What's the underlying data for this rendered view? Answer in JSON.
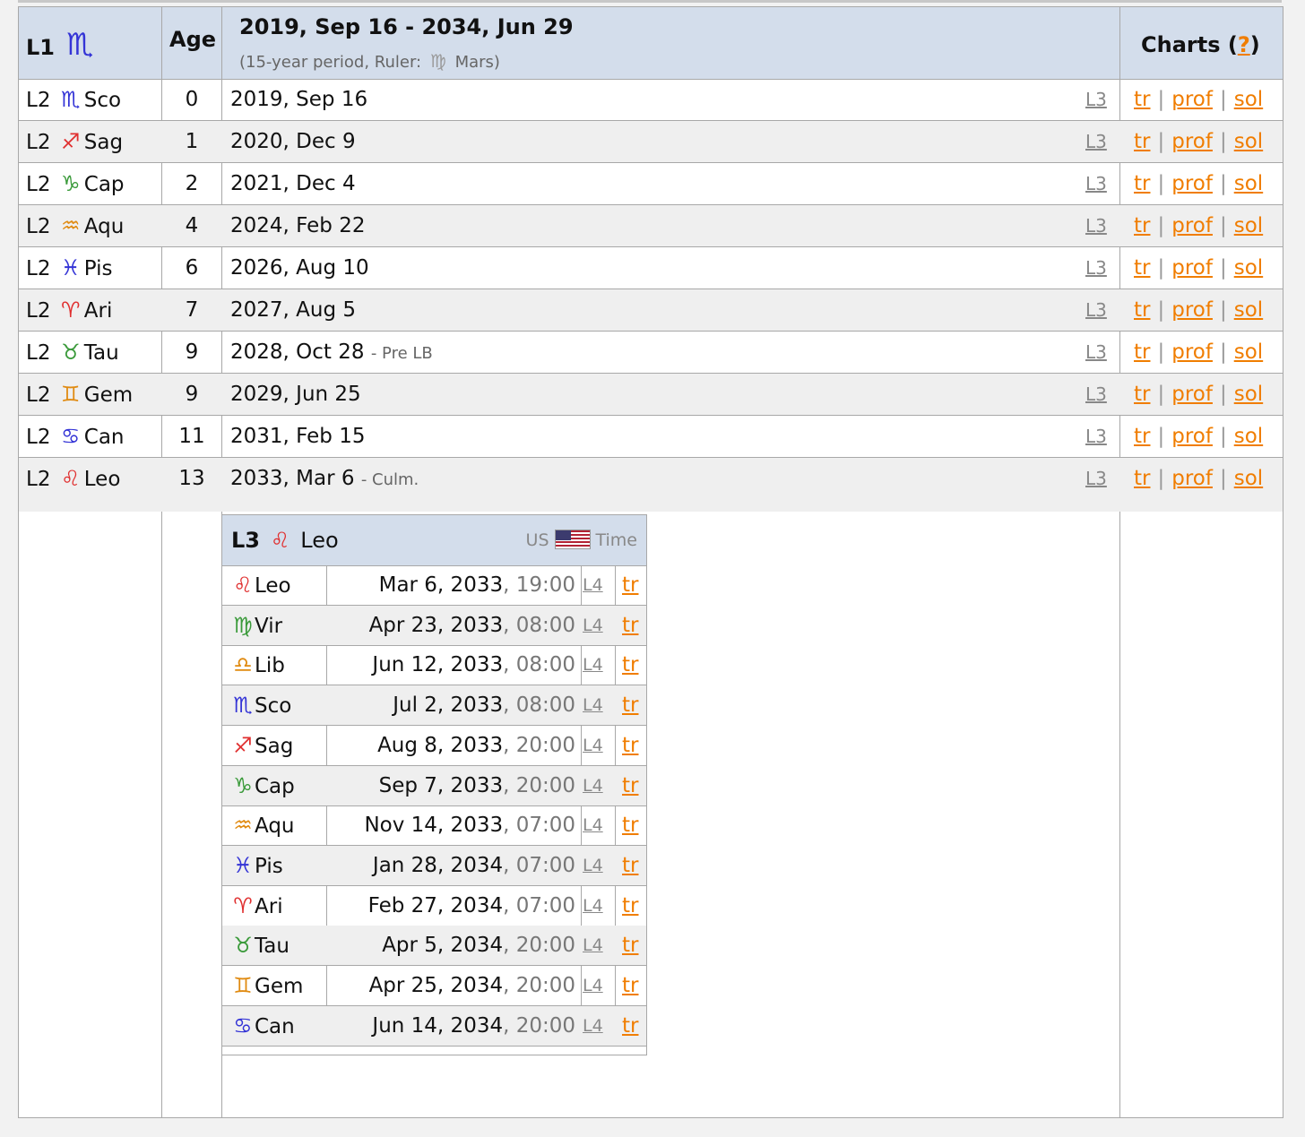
{
  "header": {
    "level_label": "L1",
    "level_sign_icon": "scorpio-icon",
    "level_symbol": "♏",
    "age_label": "Age",
    "period_title": "2019, Sep 16 - 2034, Jun 29",
    "period_sub_prefix": "(15-year period, Ruler:",
    "ruler_symbol": "♍",
    "ruler_name": "Mars)",
    "charts_label": "Charts (",
    "charts_help": "?",
    "charts_close": ")"
  },
  "rows": [
    {
      "level": "L2",
      "symbol": "♏",
      "abbr": "Sco",
      "age": "0",
      "date": "2019, Sep 16",
      "note": "",
      "l3": "L3",
      "tr": "tr",
      "prof": "prof",
      "sol": "sol"
    },
    {
      "level": "L2",
      "symbol": "♐",
      "abbr": "Sag",
      "age": "1",
      "date": "2020, Dec 9",
      "note": "",
      "l3": "L3",
      "tr": "tr",
      "prof": "prof",
      "sol": "sol"
    },
    {
      "level": "L2",
      "symbol": "♑",
      "abbr": "Cap",
      "age": "2",
      "date": "2021, Dec 4",
      "note": "",
      "l3": "L3",
      "tr": "tr",
      "prof": "prof",
      "sol": "sol"
    },
    {
      "level": "L2",
      "symbol": "♒",
      "abbr": "Aqu",
      "age": "4",
      "date": "2024, Feb 22",
      "note": "",
      "l3": "L3",
      "tr": "tr",
      "prof": "prof",
      "sol": "sol"
    },
    {
      "level": "L2",
      "symbol": "♓",
      "abbr": "Pis",
      "age": "6",
      "date": "2026, Aug 10",
      "note": "",
      "l3": "L3",
      "tr": "tr",
      "prof": "prof",
      "sol": "sol"
    },
    {
      "level": "L2",
      "symbol": "♈",
      "abbr": "Ari",
      "age": "7",
      "date": "2027, Aug 5",
      "note": "",
      "l3": "L3",
      "tr": "tr",
      "prof": "prof",
      "sol": "sol"
    },
    {
      "level": "L2",
      "symbol": "♉",
      "abbr": "Tau",
      "age": "9",
      "date": "2028, Oct 28",
      "note": "- Pre LB",
      "l3": "L3",
      "tr": "tr",
      "prof": "prof",
      "sol": "sol"
    },
    {
      "level": "L2",
      "symbol": "♊",
      "abbr": "Gem",
      "age": "9",
      "date": "2029, Jun 25",
      "note": "",
      "l3": "L3",
      "tr": "tr",
      "prof": "prof",
      "sol": "sol"
    },
    {
      "level": "L2",
      "symbol": "♋",
      "abbr": "Can",
      "age": "11",
      "date": "2031, Feb 15",
      "note": "",
      "l3": "L3",
      "tr": "tr",
      "prof": "prof",
      "sol": "sol"
    },
    {
      "level": "L2",
      "symbol": "♌",
      "abbr": "Leo",
      "age": "13",
      "date": "2033, Mar 6",
      "note": "- Culm.",
      "l3": "L3",
      "tr": "tr",
      "prof": "prof",
      "sol": "sol"
    }
  ],
  "separator": "|",
  "subtable": {
    "level": "L3",
    "symbol": "♌",
    "name": "Leo",
    "tz_left": "US",
    "tz_right": "Time",
    "rows": [
      {
        "symbol": "♌",
        "abbr": "Leo",
        "date": "Mar 6, 2033",
        "time": ", 19:00",
        "l4": "L4",
        "tr": "tr"
      },
      {
        "symbol": "♍",
        "abbr": "Vir",
        "date": "Apr 23, 2033",
        "time": ", 08:00",
        "l4": "L4",
        "tr": "tr"
      },
      {
        "symbol": "♎",
        "abbr": "Lib",
        "date": "Jun 12, 2033",
        "time": ", 08:00",
        "l4": "L4",
        "tr": "tr"
      },
      {
        "symbol": "♏",
        "abbr": "Sco",
        "date": "Jul 2, 2033",
        "time": ", 08:00",
        "l4": "L4",
        "tr": "tr"
      },
      {
        "symbol": "♐",
        "abbr": "Sag",
        "date": "Aug 8, 2033",
        "time": ", 20:00",
        "l4": "L4",
        "tr": "tr"
      },
      {
        "symbol": "♑",
        "abbr": "Cap",
        "date": "Sep 7, 2033",
        "time": ", 20:00",
        "l4": "L4",
        "tr": "tr"
      },
      {
        "symbol": "♒",
        "abbr": "Aqu",
        "date": "Nov 14, 2033",
        "time": ", 07:00",
        "l4": "L4",
        "tr": "tr"
      },
      {
        "symbol": "♓",
        "abbr": "Pis",
        "date": "Jan 28, 2034",
        "time": ", 07:00",
        "l4": "L4",
        "tr": "tr"
      },
      {
        "symbol": "♈",
        "abbr": "Ari",
        "date": "Feb 27, 2034",
        "time": ", 07:00",
        "l4": "L4",
        "tr": "tr"
      },
      {
        "symbol": "♉",
        "abbr": "Tau",
        "date": "Apr 5, 2034",
        "time": ", 20:00",
        "l4": "L4",
        "tr": "tr"
      },
      {
        "symbol": "♊",
        "abbr": "Gem",
        "date": "Apr 25, 2034",
        "time": ", 20:00",
        "l4": "L4",
        "tr": "tr"
      },
      {
        "symbol": "♋",
        "abbr": "Can",
        "date": "Jun 14, 2034",
        "time": ", 20:00",
        "l4": "L4",
        "tr": "tr"
      }
    ]
  },
  "colors": {
    "header_bg": "#d3ddeb",
    "link_orange": "#f07d00",
    "alt_row": "#efefef",
    "border": "#a8a8a8"
  }
}
